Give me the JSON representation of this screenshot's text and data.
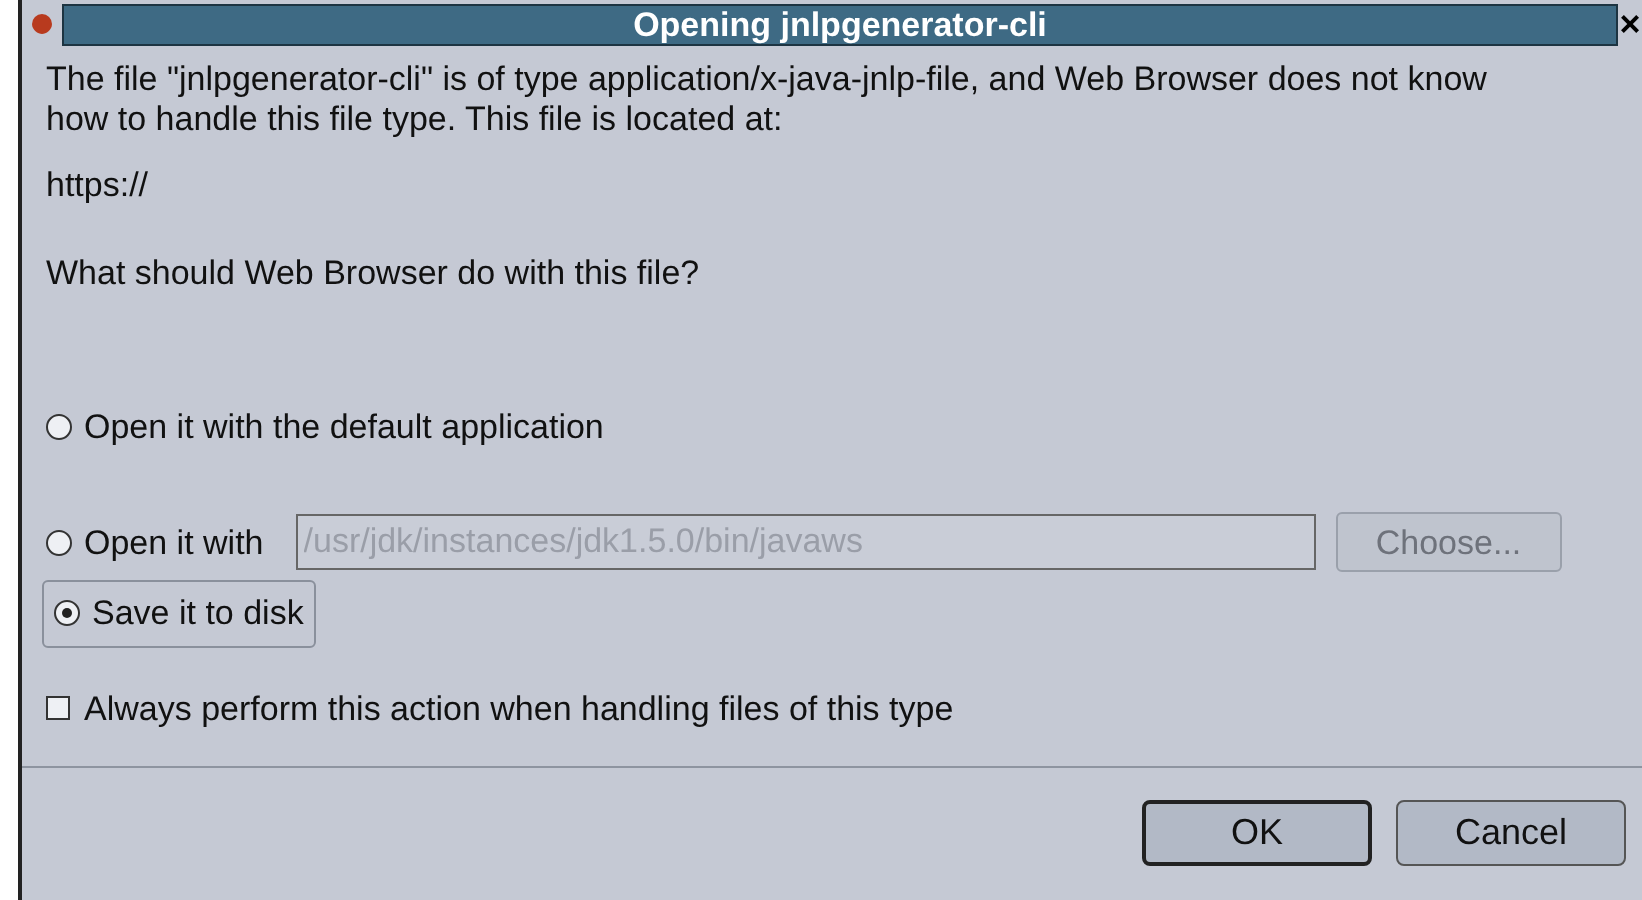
{
  "window": {
    "title": "Opening jnlpgenerator-cli",
    "close": "×"
  },
  "message": "The file \"jnlpgenerator-cli\" is of type application/x-java-jnlp-file, and Web Browser does not know how to handle this file type. This file is located at:",
  "location": "https://",
  "question": "What should Web Browser do with this file?",
  "options": [
    {
      "label": "Open it with the default application",
      "selected": false,
      "focused": false
    },
    {
      "label": "Open it with",
      "selected": false,
      "focused": false
    },
    {
      "label": "Save it to disk",
      "selected": true,
      "focused": true
    }
  ],
  "app_field": {
    "value": "/usr/jdk/instances/jdk1.5.0/bin/javaws",
    "disabled": true
  },
  "choose_button": {
    "label": "Choose...",
    "disabled": true
  },
  "always": {
    "label": "Always perform this action when handling files of this type",
    "checked": false
  },
  "buttons": [
    {
      "label": "OK",
      "default": true
    },
    {
      "label": "Cancel",
      "default": false
    }
  ]
}
